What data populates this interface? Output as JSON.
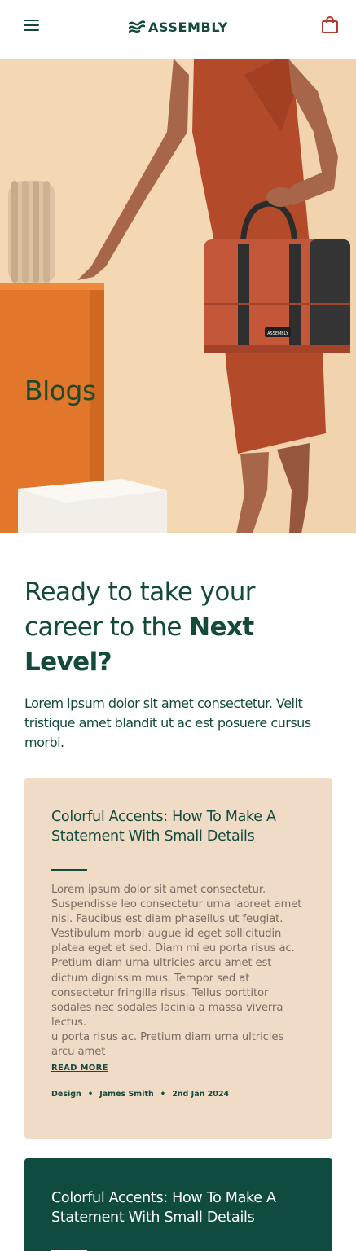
{
  "header": {
    "brand": "ASSEMBLY",
    "menu_icon": "hamburger-menu-icon",
    "cart_icon": "shopping-bag-icon",
    "logo_icon": "wave-logo-icon"
  },
  "hero": {
    "title": "Blogs",
    "bag_label": "ASSEMBLY"
  },
  "intro": {
    "heading_plain": "Ready to take your career to the ",
    "heading_bold": "Next Level?",
    "text": "Lorem ipsum dolor sit amet consectetur. Velit tristique amet blandit ut ac est posuere cursus morbi."
  },
  "posts": [
    {
      "title": "Colorful Accents: How To Make A Statement With Small Details",
      "body": "Lorem ipsum dolor sit amet consectetur. Suspendisse leo consectetur urna laoreet amet nisi. Faucibus est diam phasellus ut feugiat. Vestibulum morbi augue id eget sollicitudin platea eget et sed. Diam mi eu porta risus ac. Pretium diam urna ultricies arcu amet est dictum dignissim mus. Tempor sed at consectetur fringilla risus. Tellus porttitor sodales nec sodales lacinia a massa viverra lectus.",
      "body_extra": "u porta risus ac. Pretium diam urna ultricies arcu amet",
      "read_more": "READ MORE",
      "category": "Design",
      "author": "James Smith",
      "date": "2nd Jan 2024",
      "separator": "•"
    },
    {
      "title": "Colorful Accents: How To Make A Statement With Small Details"
    }
  ],
  "colors": {
    "brand_green": "#134a3c",
    "card_beige": "#f0dbc7",
    "card_dark": "#0f4b3e",
    "hero_bg": "#f4d8b4"
  }
}
